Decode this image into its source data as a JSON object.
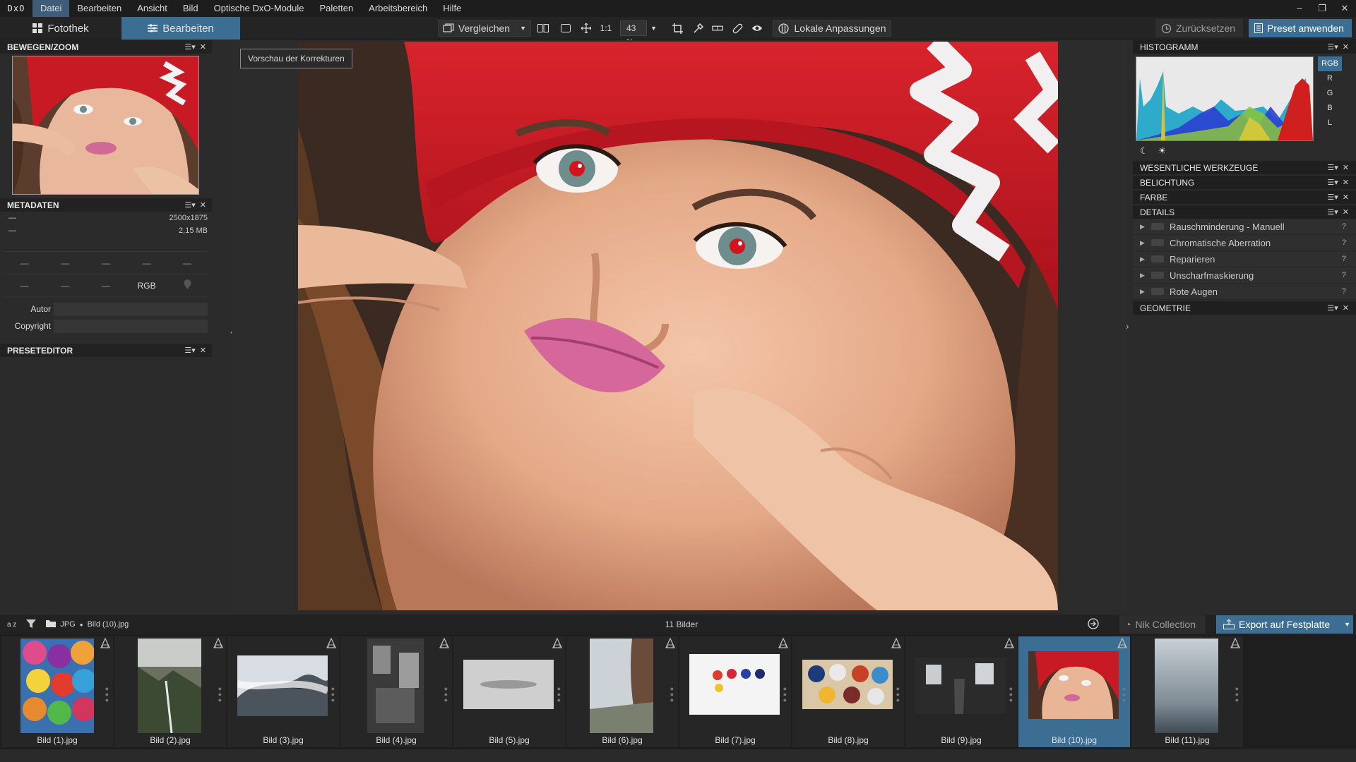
{
  "app": {
    "logo": "DxO"
  },
  "menu": [
    "Datei",
    "Bearbeiten",
    "Ansicht",
    "Bild",
    "Optische DxO-Module",
    "Paletten",
    "Arbeitsbereich",
    "Hilfe"
  ],
  "window_controls": [
    "–",
    "❐",
    "✕"
  ],
  "toolbar": {
    "tab_library": "Fotothek",
    "tab_edit": "Bearbeiten",
    "compare": "Vergleichen",
    "one_to_one": "1:1",
    "zoom": "43 %",
    "local_adjust": "Lokale Anpassungen",
    "reset": "Zurücksetzen",
    "apply_preset": "Preset anwenden"
  },
  "left_panel": {
    "move_zoom_title": "BEWEGEN/ZOOM",
    "metadata_title": "METADATEN",
    "meta_rows": [
      {
        "label": "—",
        "value": "2500x1875"
      },
      {
        "label": "—",
        "value": "2,15 MB"
      }
    ],
    "meta_grid_row1": [
      "—",
      "—",
      "—",
      "—",
      "—"
    ],
    "meta_grid_row2": [
      "—",
      "—",
      "—",
      "RGB",
      ""
    ],
    "author_label": "Autor",
    "copyright_label": "Copyright",
    "preset_editor_title": "PRESETEDITOR"
  },
  "canvas": {
    "preview_label": "Vorschau der Korrekturen"
  },
  "right_panel": {
    "histogram_title": "HISTOGRAMM",
    "histo_channels": [
      "RGB",
      "R",
      "G",
      "B",
      "L"
    ],
    "sections": [
      "WESENTLICHE WERKZEUGE",
      "BELICHTUNG",
      "FARBE",
      "DETAILS"
    ],
    "details_items": [
      "Rauschminderung - Manuell",
      "Chromatische Aberration",
      "Reparieren",
      "Unscharfmaskierung",
      "Rote Augen"
    ],
    "geometry_title": "GEOMETRIE",
    "help": "?"
  },
  "filmstrip_bar": {
    "sort": "a z",
    "format": "JPG",
    "current": "Bild (10).jpg",
    "count": "11 Bilder",
    "nik": "Nik Collection",
    "export": "Export auf Festplatte"
  },
  "thumbnails": [
    {
      "name": "Bild (1).jpg"
    },
    {
      "name": "Bild (2).jpg"
    },
    {
      "name": "Bild (3).jpg"
    },
    {
      "name": "Bild (4).jpg"
    },
    {
      "name": "Bild (5).jpg"
    },
    {
      "name": "Bild (6).jpg"
    },
    {
      "name": "Bild (7).jpg"
    },
    {
      "name": "Bild (8).jpg"
    },
    {
      "name": "Bild (9).jpg"
    },
    {
      "name": "Bild (10).jpg"
    },
    {
      "name": "Bild (11).jpg"
    }
  ],
  "selected_thumbnail": "Bild (10).jpg",
  "colors": {
    "accent": "#3c6e94",
    "panel": "#2b2b2b",
    "dark": "#1d1d1d"
  }
}
